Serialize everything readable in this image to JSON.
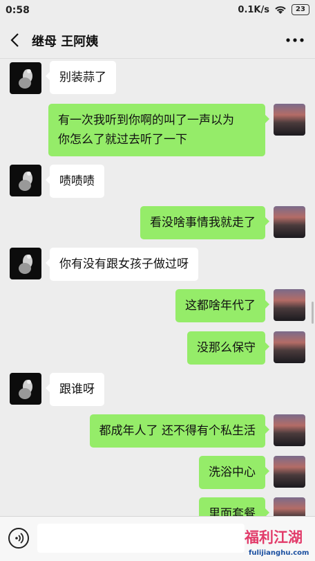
{
  "status_bar": {
    "time": "0:58",
    "speed": "0.1K/s",
    "battery": "23"
  },
  "header": {
    "title": "继母 王阿姨"
  },
  "messages": [
    {
      "sender": "other",
      "text": "别装蒜了"
    },
    {
      "sender": "me",
      "lines": [
        "有一次我听到你啊的叫了一声以为",
        "你怎么了就过去听了一下"
      ]
    },
    {
      "sender": "other",
      "text": "啧啧啧"
    },
    {
      "sender": "me",
      "text": "看没啥事情我就走了"
    },
    {
      "sender": "other",
      "text": "你有没有跟女孩子做过呀"
    },
    {
      "sender": "me",
      "text": "这都啥年代了"
    },
    {
      "sender": "me",
      "text": "没那么保守"
    },
    {
      "sender": "other",
      "text": "跟谁呀"
    },
    {
      "sender": "me",
      "text": "都成年人了  还不得有个私生活"
    },
    {
      "sender": "me",
      "text": "洗浴中心"
    },
    {
      "sender": "me",
      "text": "里面套餐"
    }
  ],
  "input": {
    "value": "",
    "placeholder": ""
  },
  "watermark": {
    "title": "福利江湖",
    "url": "fulijianghu.com"
  },
  "colors": {
    "background": "#ededed",
    "my_bubble": "#95ec69",
    "other_bubble": "#ffffff"
  }
}
